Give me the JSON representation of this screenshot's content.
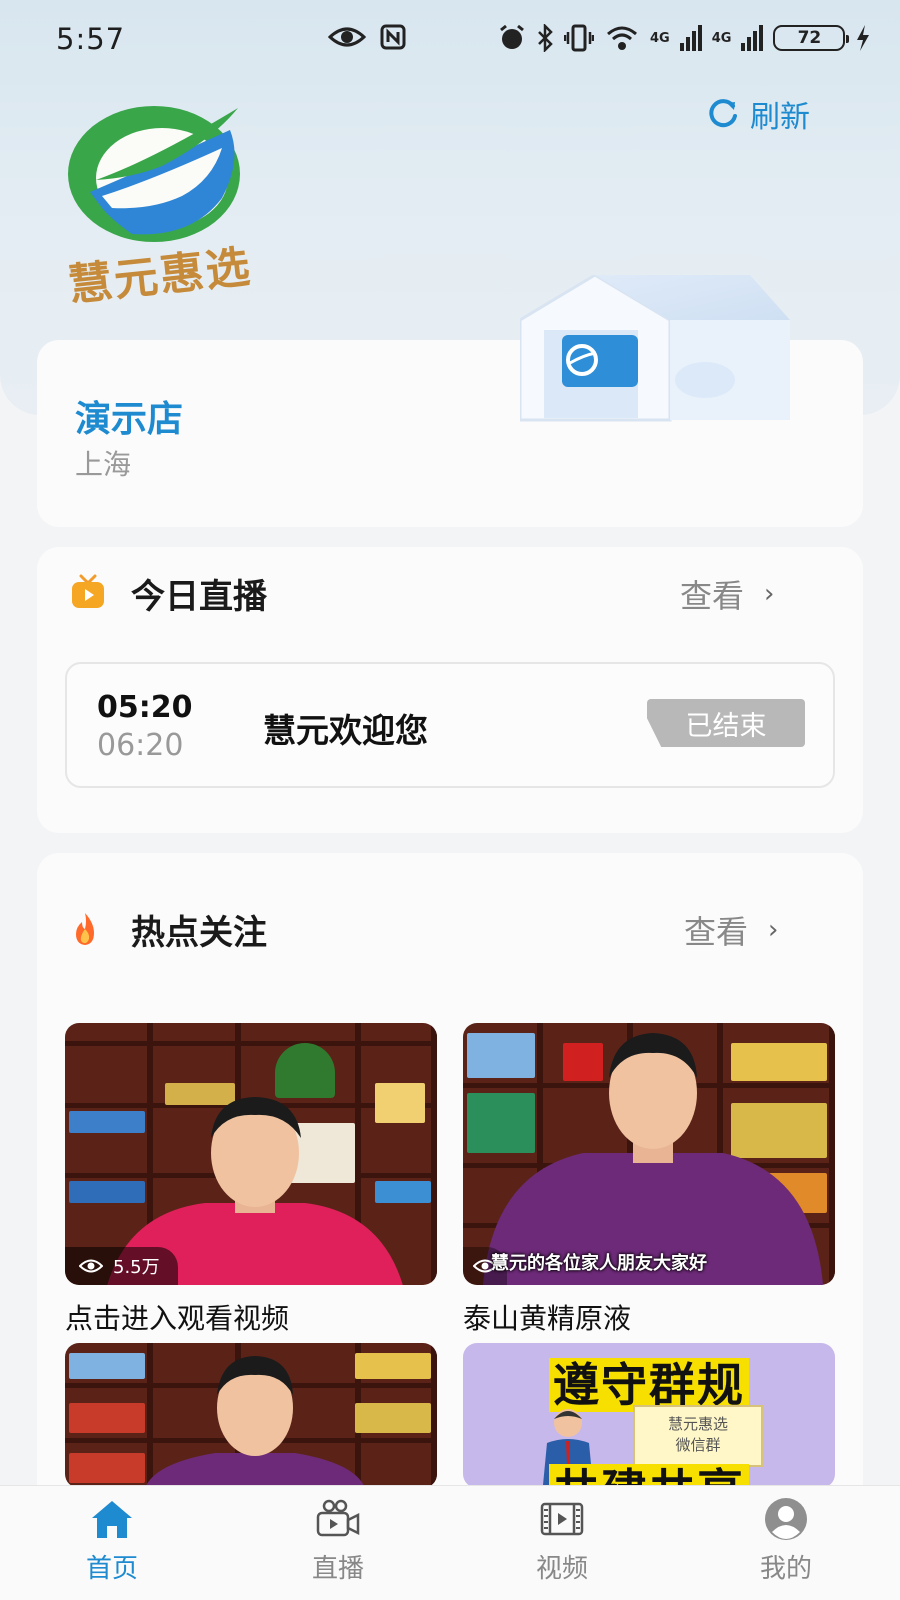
{
  "status_bar": {
    "time": "5:57",
    "icons": [
      "eye-icon",
      "nfc-icon",
      "alarm-icon",
      "bluetooth-icon",
      "vibrate-icon",
      "wifi-icon",
      "signal-4g-icon",
      "signal-4g-icon",
      "battery-icon",
      "charging-icon"
    ],
    "network_1": "4G",
    "network_2": "4G",
    "battery": "72"
  },
  "header": {
    "refresh_label": "刷新",
    "logo_text": "慧元惠选",
    "accent_color": "#1e8ad0"
  },
  "store": {
    "name": "演示店",
    "city": "上海"
  },
  "live_section": {
    "title": "今日直播",
    "more_label": "查看",
    "items": [
      {
        "start": "05:20",
        "end": "06:20",
        "title": "慧元欢迎您",
        "status": "已结束"
      }
    ]
  },
  "hot_section": {
    "title": "热点关注",
    "more_label": "查看",
    "videos": [
      {
        "title": "点击进入观看视频",
        "views": "5.5万",
        "subtitle": ""
      },
      {
        "title": "泰山黄精原液",
        "views": "",
        "subtitle": "慧元的各位家人朋友大家好"
      },
      {
        "title": "",
        "views": "",
        "subtitle": ""
      },
      {
        "title": "",
        "views": "",
        "subtitle": "",
        "promo_lines": [
          "遵守群规",
          "共建共享"
        ],
        "promo_board": "慧元惠选\n微信群"
      }
    ]
  },
  "tabbar": {
    "tabs": [
      {
        "label": "首页",
        "icon": "home-icon",
        "active": true
      },
      {
        "label": "直播",
        "icon": "video-camera-icon",
        "active": false
      },
      {
        "label": "视频",
        "icon": "film-icon",
        "active": false
      },
      {
        "label": "我的",
        "icon": "user-avatar-icon",
        "active": false
      }
    ]
  }
}
